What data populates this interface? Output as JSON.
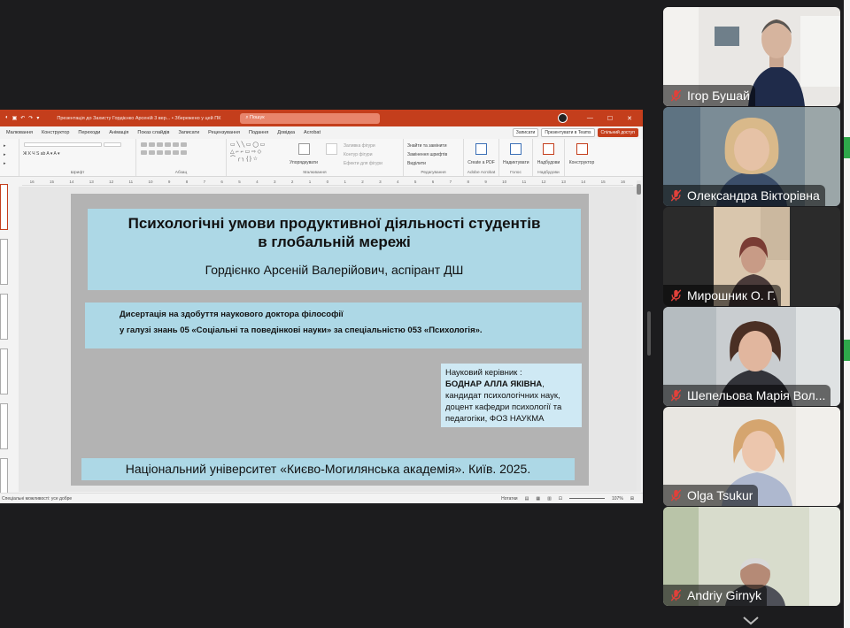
{
  "powerpoint": {
    "title_bar": {
      "document_title": "Презентація до Захисту Гордієнко Арсеній 3 вер...  •  Збережено у цей ПК",
      "search_placeholder": "Пошук"
    },
    "tabs": [
      "Малювання",
      "Конструктор",
      "Переходи",
      "Анімація",
      "Показ слайдів",
      "Записати",
      "Рецензування",
      "Подання",
      "Довідка",
      "Acrobat"
    ],
    "right_buttons": {
      "record": "Записати",
      "present_teams": "Презентувати в Teams",
      "share": "Спільний доступ"
    },
    "ribbon_groups": {
      "font": "Шрифт",
      "paragraph": "Абзац",
      "drawing": "Малювання",
      "editing": "Редагування",
      "adobe": "Adobe Acrobat",
      "voice": "Голос",
      "addins": "Надбудови"
    },
    "ribbon_items": {
      "arrange": "Упорядкувати",
      "shape_fill": "Заливка фігури",
      "shape_outline": "Контур фігури",
      "shape_effects": "Ефекти для фігури",
      "find_replace": "Знайти та замінити",
      "replace_fonts": "Замінення шрифтів",
      "select": "Виділити",
      "create_pdf": "Create a PDF",
      "dictate": "Надиктувати",
      "addins": "Надбудови",
      "designer": "Конструктор"
    },
    "ruler_marks": [
      "16",
      "15",
      "14",
      "13",
      "12",
      "11",
      "10",
      "9",
      "8",
      "7",
      "6",
      "5",
      "4",
      "3",
      "2",
      "1",
      "0",
      "1",
      "2",
      "3",
      "4",
      "5",
      "6",
      "7",
      "8",
      "9",
      "10",
      "11",
      "12",
      "13",
      "14",
      "15",
      "16"
    ],
    "slide": {
      "title_line1": "Психологічні умови продуктивної діяльності студентів",
      "title_line2": "в глобальній мережі",
      "author": "Гордієнко Арсеній Валерійович, аспірант ДШ",
      "dissertation_line1": "Дисертація на здобуття наукового доктора філософії",
      "dissertation_line2": "у галузі знань 05 «Соціальні та поведінкові науки» за спеціальністю 053 «Психологія».",
      "supervisor_label": "Науковий керівник :",
      "supervisor_name": "БОДНАР АЛЛА ЯКІВНА",
      "supervisor_details": "кандидат психологічних наук, доцент  кафедри психології та педагогіки, ФОЗ НАУКМА",
      "university": "Національний університет «Києво-Могилянська академія». Київ. 2025."
    },
    "status_bar": {
      "accessibility": "Спеціальні можливості: усе добре",
      "notes": "Нотатки",
      "zoom": "107%"
    }
  },
  "participants": [
    {
      "name": "Ігор Бушай",
      "muted": true
    },
    {
      "name": "Олександра Вікторівна",
      "muted": true
    },
    {
      "name": "Мирошник О. Г.",
      "muted": true
    },
    {
      "name": "Шепельова Марія Вол...",
      "muted": true
    },
    {
      "name": "Olga Tsukur",
      "muted": true
    },
    {
      "name": "Andriy Girnyk",
      "muted": true
    }
  ],
  "colors": {
    "powerpoint_accent": "#c43e1c",
    "slide_box": "#add8e6",
    "muted_icon": "#e0413a",
    "meeting_background": "#1c1c1e"
  }
}
